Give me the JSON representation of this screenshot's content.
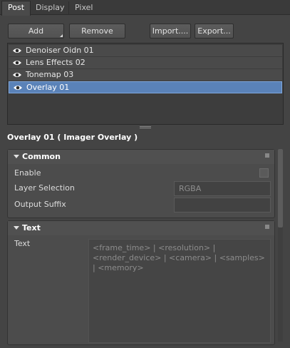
{
  "tabs": [
    {
      "label": "Post",
      "active": true
    },
    {
      "label": "Display",
      "active": false
    },
    {
      "label": "Pixel",
      "active": false
    }
  ],
  "toolbar": {
    "add_label": "Add",
    "remove_label": "Remove",
    "import_label": "Import....",
    "export_label": "Export..."
  },
  "effects": [
    {
      "label": "Denoiser Oidn 01",
      "visible": true,
      "selected": false
    },
    {
      "label": "Lens Effects 02",
      "visible": true,
      "selected": false
    },
    {
      "label": "Tonemap 03",
      "visible": true,
      "selected": false
    },
    {
      "label": "Overlay 01",
      "visible": true,
      "selected": true
    }
  ],
  "details": {
    "heading": "Overlay 01  ( Imager Overlay )",
    "common": {
      "title": "Common",
      "enable_label": "Enable",
      "enable_checked": false,
      "layer_label": "Layer Selection",
      "layer_value": "RGBA",
      "suffix_label": "Output Suffix",
      "suffix_value": ""
    },
    "text": {
      "title": "Text",
      "text_label": "Text",
      "text_value": "<frame_time> | <resolution> | <render_device> | <camera> | <samples> | <memory>"
    }
  },
  "colors": {
    "selection": "#5a82b8",
    "background": "#444444"
  }
}
